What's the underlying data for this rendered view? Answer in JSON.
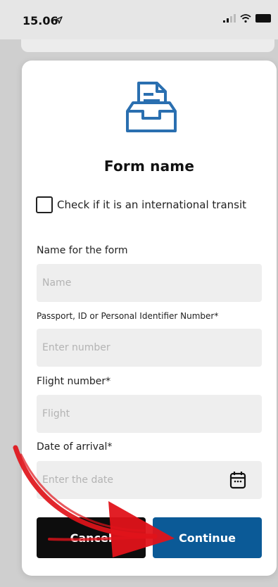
{
  "status_bar": {
    "time": "15.06",
    "icons": [
      "location-arrow-icon",
      "signal-icon",
      "wifi-icon",
      "battery-icon"
    ]
  },
  "modal": {
    "icon": "inbox-document-icon",
    "title": "Form name",
    "checkbox": {
      "label": "Check if it is an international transit",
      "checked": false
    },
    "fields": [
      {
        "label": "Name for the form",
        "placeholder": "Name"
      },
      {
        "label": "Passport, ID or Personal Identifier Number*",
        "placeholder": "Enter number"
      },
      {
        "label": "Flight number*",
        "placeholder": "Flight"
      },
      {
        "label": "Date of arrival*",
        "placeholder": "Enter the date",
        "icon": "calendar-icon"
      }
    ],
    "buttons": {
      "cancel": "Cancel",
      "continue": "Continue"
    }
  },
  "colors": {
    "accent": "#0b5a97",
    "icon": "#2a6fb0",
    "cancel_bg": "#0d0d0d",
    "annotation": "#e0131a"
  }
}
